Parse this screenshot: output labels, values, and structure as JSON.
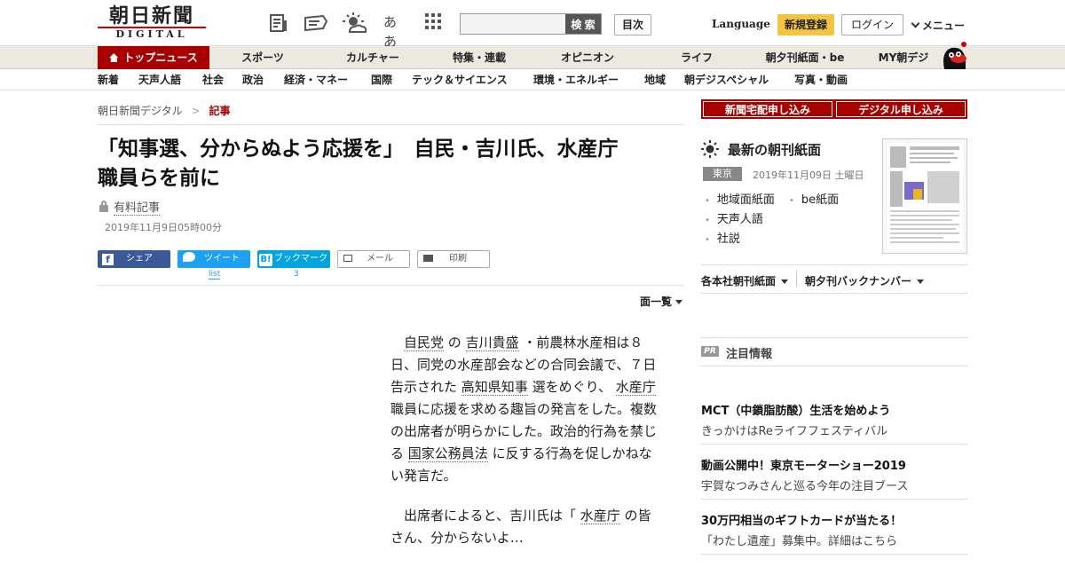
{
  "header": {
    "logo_main": "朝日新聞",
    "logo_sub": "DIGITAL",
    "icons": [
      "newspaper-icon",
      "tag-icon",
      "weather-icon",
      "font-size-icon",
      "grid-menu-icon"
    ],
    "font_size_label": "ああ",
    "search_placeholder": "",
    "search_button": "検 索",
    "toc_button": "目次",
    "language_label": "Language",
    "register_button": "新規登録",
    "login_button": "ログイン",
    "menu_label": "メニュー"
  },
  "nav": {
    "items": [
      "トップニュース",
      "スポーツ",
      "カルチャー",
      "特集・連載",
      "オピニオン",
      "ライフ",
      "朝夕刊紙面・be",
      "MY朝デジ"
    ],
    "active_index": 0
  },
  "subnav": {
    "items": [
      "新着",
      "天声人語",
      "社会",
      "政治",
      "経済・マネー",
      "国際",
      "テック＆サイエンス",
      "環境・エネルギー",
      "地域",
      "朝デジスペシャル",
      "写真・動画"
    ]
  },
  "article": {
    "breadcrumb": [
      "朝日新聞デジタル",
      "記事"
    ],
    "breadcrumb_sep": ">",
    "title_line1": "「知事選、分からぬよう応援を」　自民・吉川氏、水産庁",
    "title_line2": "職員らを前に",
    "paid_label": "有料記事",
    "date": "2019年11月9日05時00分",
    "share": {
      "facebook": "シェア",
      "twitter": "ツイート",
      "twitter_count": "list",
      "hatena": "ブックマーク",
      "hatena_count": "3",
      "mail": "メール",
      "print": "印刷"
    },
    "page_list_label": "面一覧",
    "body": {
      "p1": [
        "自民党",
        "の",
        "吉川貴盛",
        "・前農林水産相は８日、同党の水産部会などの合同会議で、７日告示された",
        "高知県知事",
        "選をめぐり、",
        "水産庁",
        "職員に応援を求める趣旨の発言をした。複数の出席者が明らかにした。政治的行為を禁じる",
        "国家公務員法",
        "に反する行為を促しかねない発言だ。"
      ],
      "p2": [
        "出席者によると、吉川氏は「",
        "水産庁",
        "の皆さん、分からないよ…"
      ]
    }
  },
  "sidebar": {
    "btn_delivery": "新聞宅配申し込み",
    "btn_digital": "デジタル申し込み",
    "latest_title": "最新の朝刊紙面",
    "edition": "東京",
    "edition_date": "2019年11月09日 土曜日",
    "links": [
      "地域面紙面",
      "be紙面",
      "天声人語",
      "社説"
    ],
    "dropdown1": "各本社朝刊紙面",
    "dropdown2": "朝夕刊バックナンバー",
    "pr_badge": "PR",
    "pr_heading": "注目情報",
    "pr_items": [
      {
        "title": "MCT（中鎖脂肪酸）生活を始めよう",
        "sub": "きっかけはReライフフェスティバル"
      },
      {
        "title": "動画公開中！東京モーターショー2019",
        "sub": "宇賀なつみさんと巡る今年の注目ブース"
      },
      {
        "title": "30万円相当のギフトカードが当たる！",
        "sub": "「わたし遺産」募集中。詳細はこちら"
      }
    ]
  },
  "colors": {
    "accent": "#a80000",
    "register": "#f5c542",
    "nav_bg": "#ece9e1",
    "facebook": "#3b5998",
    "twitter": "#1da1f2",
    "hatena": "#00a4de"
  }
}
